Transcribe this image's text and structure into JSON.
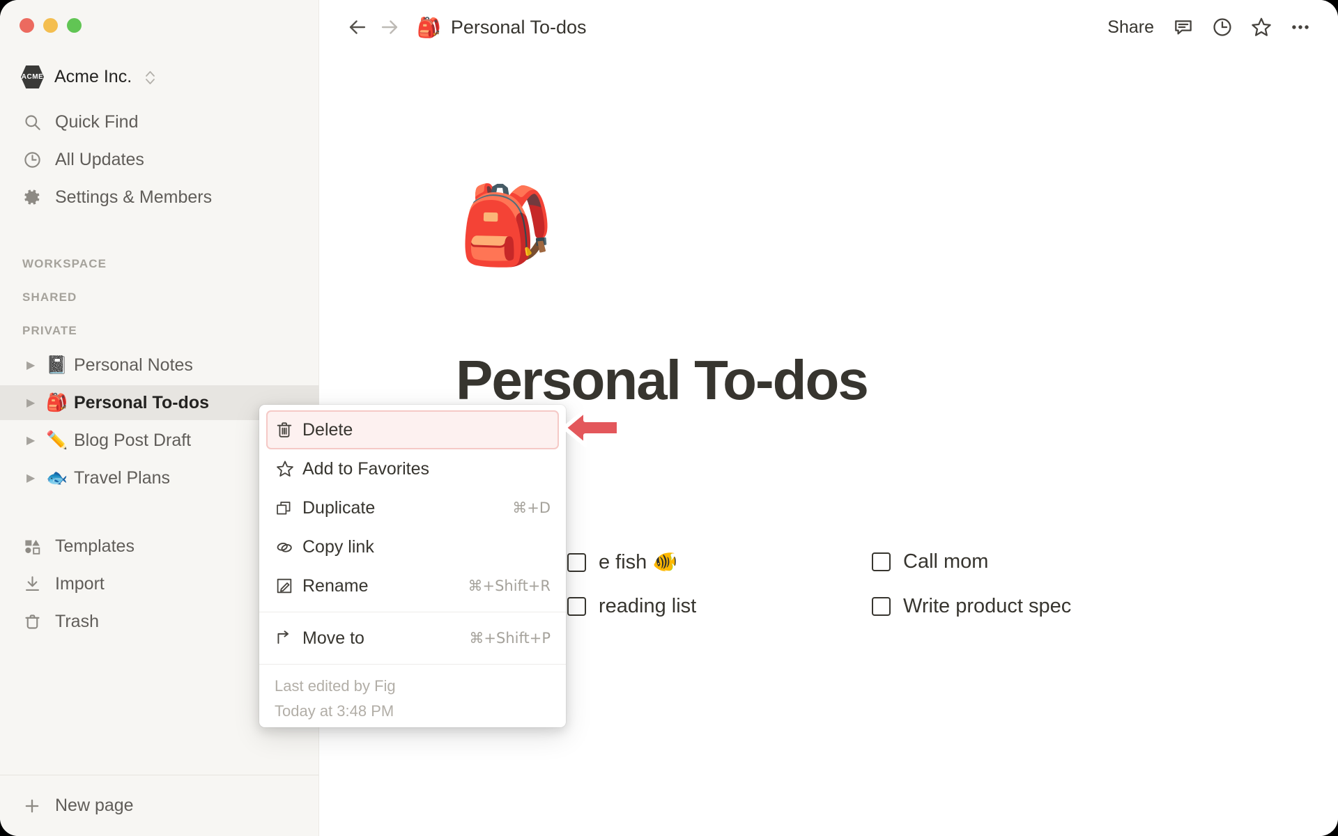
{
  "window": {
    "traffic_lights": [
      "close",
      "minimize",
      "zoom"
    ],
    "colors": {
      "close": "#ec6a5f",
      "minimize": "#f4be4f",
      "zoom": "#61c554",
      "danger_bg": "#fdf1f0",
      "danger_border": "#f5c9c6",
      "annotation_arrow": "#e3575b",
      "sidebar_bg": "#f7f6f3",
      "selected_row": "#e7e5e1"
    }
  },
  "sidebar": {
    "workspace": {
      "name": "Acme Inc.",
      "logo_text": "ACME",
      "switcher_icon": "chevron-updown-icon"
    },
    "nav": [
      {
        "label": "Quick Find",
        "icon": "search-icon"
      },
      {
        "label": "All Updates",
        "icon": "clock-icon"
      },
      {
        "label": "Settings & Members",
        "icon": "gear-icon"
      }
    ],
    "sections": [
      {
        "label": "WORKSPACE"
      },
      {
        "label": "SHARED"
      },
      {
        "label": "PRIVATE"
      }
    ],
    "pages": [
      {
        "label": "Personal Notes",
        "emoji": "📓",
        "selected": false,
        "toggle": "collapsed"
      },
      {
        "label": "Personal To-dos",
        "emoji": "🎒",
        "selected": true,
        "toggle": "collapsed"
      },
      {
        "label": "Blog Post Draft",
        "emoji": "✏️",
        "selected": false,
        "toggle": "collapsed"
      },
      {
        "label": "Travel Plans",
        "emoji": "🐟",
        "selected": false,
        "toggle": "collapsed"
      }
    ],
    "utilities": [
      {
        "label": "Templates",
        "icon": "templates-icon"
      },
      {
        "label": "Import",
        "icon": "import-icon"
      },
      {
        "label": "Trash",
        "icon": "trash-icon"
      }
    ],
    "footer": {
      "label": "New page",
      "icon": "plus-icon"
    }
  },
  "topbar": {
    "back_icon": "arrow-left-icon",
    "forward_icon": "arrow-right-icon",
    "breadcrumb_emoji": "🎒",
    "breadcrumb_title": "Personal To-dos",
    "share_label": "Share",
    "icons": [
      {
        "name": "comment-icon"
      },
      {
        "name": "history-clock-icon"
      },
      {
        "name": "star-icon"
      },
      {
        "name": "more-horizontal-icon"
      }
    ]
  },
  "page": {
    "emoji": "🎒",
    "title": "Personal To-dos",
    "todos_left": [
      {
        "text": "e fish 🐠",
        "checked": false,
        "occluded": true
      },
      {
        "text": "reading list",
        "checked": false,
        "occluded": true
      }
    ],
    "todos_right": [
      {
        "text": "Call mom",
        "checked": false
      },
      {
        "text": "Write product spec",
        "checked": false
      }
    ]
  },
  "context_menu": {
    "items": [
      {
        "label": "Delete",
        "icon": "trash-icon",
        "shortcut": "",
        "danger": true
      },
      {
        "label": "Add to Favorites",
        "icon": "star-icon",
        "shortcut": ""
      },
      {
        "label": "Duplicate",
        "icon": "duplicate-icon",
        "shortcut": "⌘+D"
      },
      {
        "label": "Copy link",
        "icon": "link-icon",
        "shortcut": ""
      },
      {
        "label": "Rename",
        "icon": "rename-pencil-icon",
        "shortcut": "⌘+Shift+R"
      },
      {
        "label": "Move to",
        "icon": "move-to-icon",
        "shortcut": "⌘+Shift+P"
      }
    ],
    "meta": {
      "last_edited_by": "Last edited by Fig",
      "last_edited_time": "Today at 3:48 PM"
    }
  },
  "annotation": {
    "type": "arrow-left",
    "points_to": "Delete"
  }
}
